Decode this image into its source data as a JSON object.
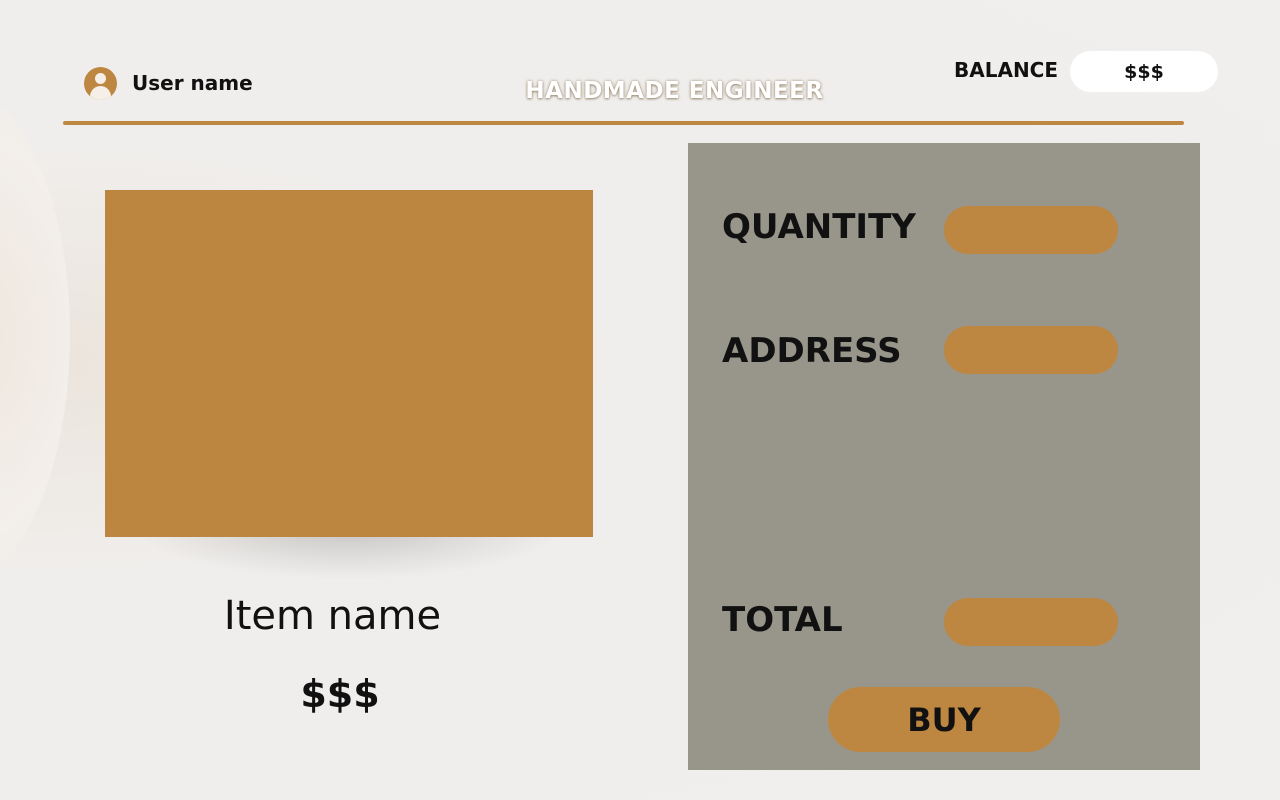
{
  "header": {
    "user_name": "User name",
    "brand_title": "HANDMADE ENGINEER",
    "balance_label": "BALANCE",
    "balance_value": "$$$",
    "avatar_icon": "user-avatar-icon"
  },
  "product": {
    "item_name": "Item name",
    "price": "$$$"
  },
  "order": {
    "quantity_label": "QUANTITY",
    "quantity_value": "",
    "address_label": "ADDRESS",
    "address_value": "",
    "total_label": "TOTAL",
    "total_value": "",
    "buy_label": "BUY"
  },
  "colors": {
    "accent": "#bd8741",
    "panel": "#98958a",
    "background": "#f0eeec",
    "text": "#111111"
  }
}
